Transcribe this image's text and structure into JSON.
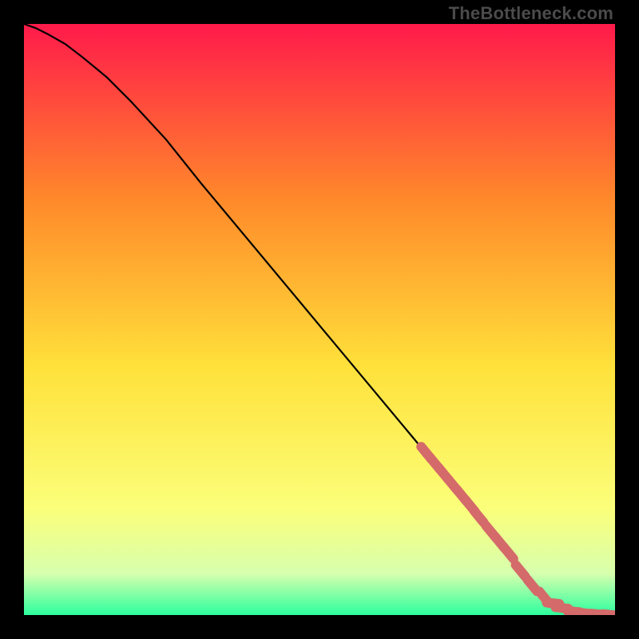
{
  "watermark": "TheBottleneck.com",
  "colors": {
    "gradient_top": "#ff1a4b",
    "gradient_mid1": "#ff8a2a",
    "gradient_mid2": "#ffe13a",
    "gradient_mid3": "#fbff7a",
    "gradient_mid4": "#d7ffae",
    "gradient_bottom": "#2cff9e",
    "curve": "#000000",
    "point": "#d46a6a"
  },
  "chart_data": {
    "type": "line",
    "title": "",
    "xlabel": "",
    "ylabel": "",
    "xlim": [
      0,
      100
    ],
    "ylim": [
      0,
      100
    ],
    "series": [
      {
        "name": "curve",
        "x": [
          0,
          2,
          4,
          7,
          10,
          14,
          18,
          24,
          30,
          40,
          50,
          60,
          70,
          78,
          84,
          88,
          90,
          92,
          94,
          96,
          98,
          100
        ],
        "y": [
          100,
          99.3,
          98.3,
          96.6,
          94.3,
          91,
          87,
          80.5,
          73,
          61,
          49,
          37,
          25,
          15,
          7.5,
          3,
          1.5,
          0.7,
          0.3,
          0.15,
          0.07,
          0.03
        ]
      }
    ],
    "points": {
      "name": "markers",
      "x": [
        68,
        69.5,
        71,
        72.5,
        74,
        75.5,
        77,
        79,
        80.5,
        82,
        84,
        86,
        88,
        89.5,
        91,
        93,
        95,
        97,
        99
      ],
      "y": [
        27.5,
        25.7,
        23.9,
        22.1,
        20.3,
        18.5,
        16.6,
        14.1,
        12.3,
        10.5,
        7.5,
        5,
        3,
        2,
        1.2,
        0.6,
        0.3,
        0.15,
        0.07
      ]
    }
  }
}
